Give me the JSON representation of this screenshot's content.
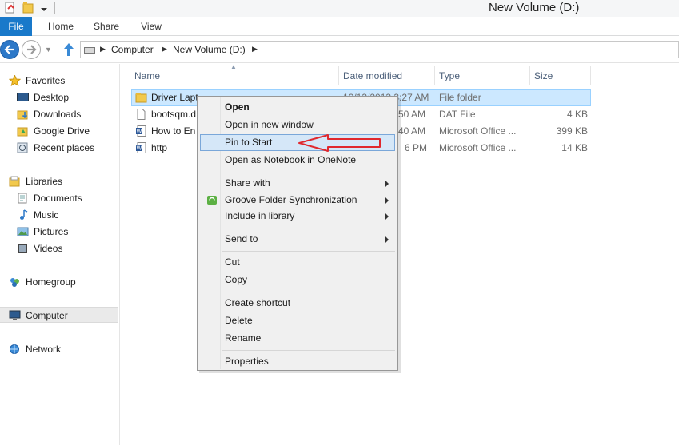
{
  "window": {
    "title": "New Volume (D:)"
  },
  "ribbon": {
    "tabs": [
      "File",
      "Home",
      "Share",
      "View"
    ]
  },
  "address": {
    "crumbs": [
      "Computer",
      "New Volume (D:)"
    ]
  },
  "nav": {
    "favorites": {
      "label": "Favorites",
      "items": [
        "Desktop",
        "Downloads",
        "Google Drive",
        "Recent places"
      ]
    },
    "libraries": {
      "label": "Libraries",
      "items": [
        "Documents",
        "Music",
        "Pictures",
        "Videos"
      ]
    },
    "homegroup": "Homegroup",
    "computer": "Computer",
    "network": "Network"
  },
  "columns": {
    "name": "Name",
    "date": "Date modified",
    "type": "Type",
    "size": "Size"
  },
  "files": [
    {
      "name": "Driver Lapt",
      "date": "10/13/2013 3:27 AM",
      "type": "File folder",
      "size": "",
      "icon": "folder-icon"
    },
    {
      "name": "bootsqm.d",
      "date": "50 AM",
      "type": "DAT File",
      "size": "4 KB",
      "icon": "file-icon"
    },
    {
      "name": "How to En",
      "date": "40 AM",
      "type": "Microsoft Office ...",
      "size": "399 KB",
      "icon": "word-doc-icon"
    },
    {
      "name": "http",
      "date": "6 PM",
      "type": "Microsoft Office ...",
      "size": "14 KB",
      "icon": "word-doc-icon"
    }
  ],
  "context_menu": {
    "open": "Open",
    "open_new_window": "Open in new window",
    "pin_to_start": "Pin to Start",
    "open_notebook": "Open as Notebook in OneNote",
    "share_with": "Share with",
    "groove_sync": "Groove Folder Synchronization",
    "include_library": "Include in library",
    "send_to": "Send to",
    "cut": "Cut",
    "copy": "Copy",
    "create_shortcut": "Create shortcut",
    "delete": "Delete",
    "rename": "Rename",
    "properties": "Properties"
  },
  "colors": {
    "accent": "#1979ca",
    "selection": "#cce8ff",
    "annotation": "#e0282e"
  }
}
